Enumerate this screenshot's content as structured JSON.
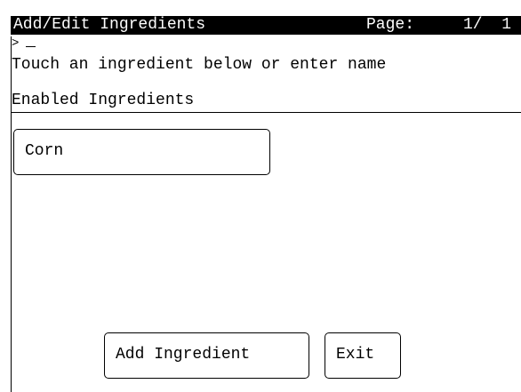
{
  "header": {
    "title": "Add/Edit Ingredients",
    "page_label": "Page:",
    "page_number": "1/  1"
  },
  "entry": {
    "prompt": ">"
  },
  "instruction": "Touch an ingredient below or enter name",
  "section": {
    "title": "Enabled Ingredients"
  },
  "ingredients": [
    {
      "label": "Corn"
    }
  ],
  "actions": {
    "add_ingredient": "Add Ingredient",
    "exit": "Exit"
  },
  "colors": {
    "background": "#ffffff",
    "foreground": "#000000"
  }
}
